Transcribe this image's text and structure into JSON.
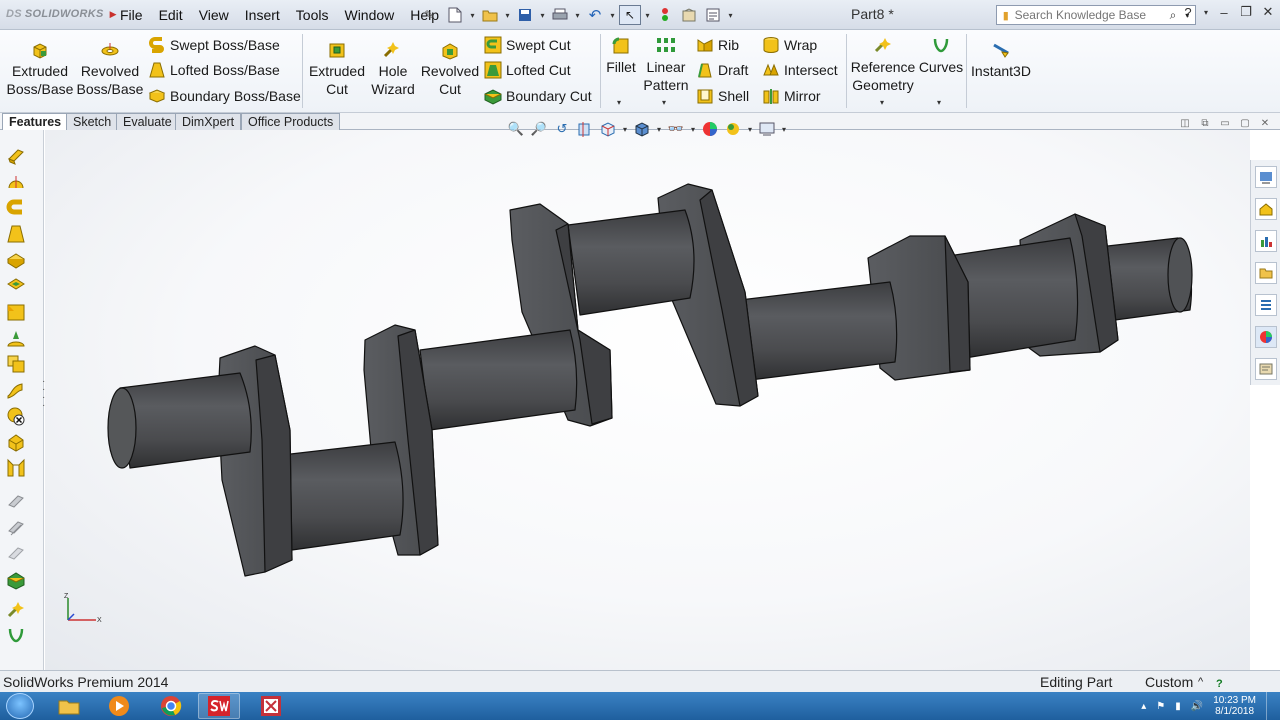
{
  "app": {
    "brand": "SOLIDWORKS",
    "document_title": "Part8 *"
  },
  "menu": [
    "File",
    "Edit",
    "View",
    "Insert",
    "Tools",
    "Window",
    "Help"
  ],
  "search": {
    "placeholder": "Search Knowledge Base"
  },
  "ribbon": {
    "extruded_boss": [
      "Extruded",
      "Boss/Base"
    ],
    "revolved_boss": [
      "Revolved",
      "Boss/Base"
    ],
    "swept_boss": "Swept Boss/Base",
    "lofted_boss": "Lofted Boss/Base",
    "boundary_boss": "Boundary Boss/Base",
    "extruded_cut": [
      "Extruded",
      "Cut"
    ],
    "hole_wizard": [
      "Hole",
      "Wizard"
    ],
    "revolved_cut": [
      "Revolved",
      "Cut"
    ],
    "swept_cut": "Swept Cut",
    "lofted_cut": "Lofted Cut",
    "boundary_cut": "Boundary Cut",
    "fillet": "Fillet",
    "linear_pattern": [
      "Linear",
      "Pattern"
    ],
    "rib": "Rib",
    "draft": "Draft",
    "shell": "Shell",
    "wrap": "Wrap",
    "intersect": "Intersect",
    "mirror": "Mirror",
    "reference_geometry": [
      "Reference",
      "Geometry"
    ],
    "curves": "Curves",
    "instant3d": "Instant3D"
  },
  "tabs": [
    "Features",
    "Sketch",
    "Evaluate",
    "DimXpert",
    "Office Products"
  ],
  "active_tab": "Features",
  "triad": {
    "z": "Z",
    "x": "X"
  },
  "status": {
    "product": "SolidWorks Premium 2014",
    "mode": "Editing Part",
    "units": "Custom",
    "units_arrow": "^"
  },
  "clock": {
    "time": "10:23 PM",
    "date": "8/1/2018"
  },
  "colors": {
    "part": "#505255",
    "part_shade": "#3a3b3d",
    "part_light": "#66686b",
    "feature_yellow": "#f2c21a",
    "taskbar": "#2a6db0"
  }
}
